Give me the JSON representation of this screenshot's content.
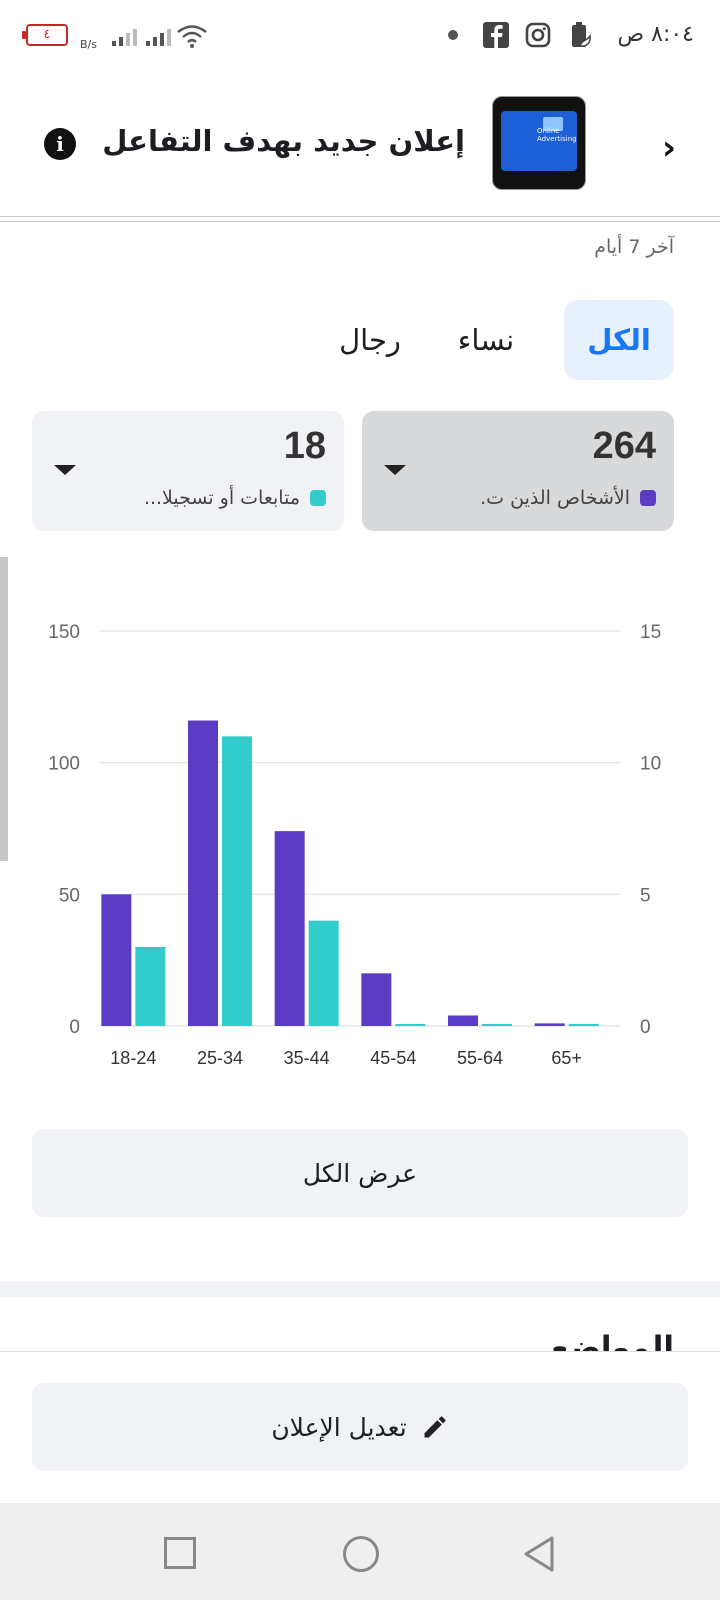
{
  "status_bar": {
    "time": "٨:٠٤ ص",
    "battery_level": "٤",
    "net_speed": "B/s",
    "icons": [
      "battery-icon",
      "signal-icon",
      "wifi-icon",
      "dot-icon",
      "facebook-icon",
      "instagram-icon",
      "battery-saver-icon"
    ]
  },
  "header": {
    "title": "إعلان جديد بهدف التفاعل",
    "thumb_text": "Online Advertising"
  },
  "period": "آخر 7 أيام",
  "gender_tabs": [
    {
      "label": "الكل",
      "active": true
    },
    {
      "label": "نساء",
      "active": false
    },
    {
      "label": "رجال",
      "active": false
    }
  ],
  "metrics": [
    {
      "value": "264",
      "label": "الأشخاص الذين ت.",
      "color": "#5b3cc4",
      "selected": true
    },
    {
      "value": "18",
      "label": "متابعات أو تسجيلا...",
      "color": "#33cccc",
      "selected": false
    }
  ],
  "chart_data": {
    "type": "bar",
    "categories": [
      "18-24",
      "25-34",
      "35-44",
      "45-54",
      "55-64",
      "65+"
    ],
    "series": [
      {
        "values": [
          50,
          116,
          74,
          20,
          4,
          1
        ],
        "color": "#5b3cc4",
        "axis": "left"
      },
      {
        "values": [
          3,
          11,
          4,
          0,
          0,
          0
        ],
        "color": "#33cccc",
        "axis": "right"
      }
    ],
    "y_left": {
      "ticks": [
        0,
        50,
        100,
        150
      ],
      "range": [
        0,
        150
      ]
    },
    "y_right": {
      "ticks": [
        0,
        5,
        10,
        15
      ],
      "range": [
        0,
        15
      ]
    },
    "grid": true
  },
  "buttons": {
    "see_all": "عرض الكل",
    "edit_ad": "تعديل الإعلان"
  },
  "next_section_heading": "المواضع"
}
